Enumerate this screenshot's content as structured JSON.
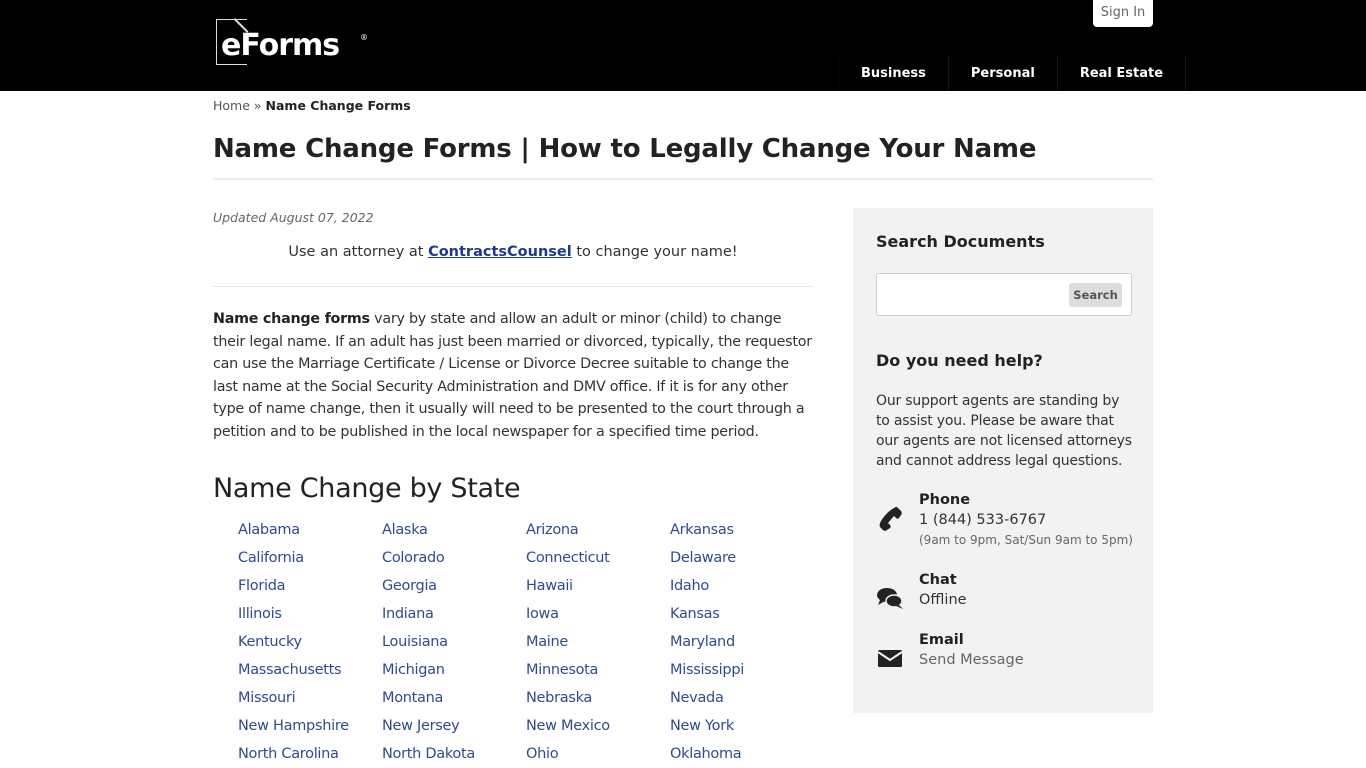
{
  "header": {
    "logo_text": "eForms",
    "logo_reg": "®",
    "signin_label": "Sign In",
    "nav": [
      {
        "label": "Business"
      },
      {
        "label": "Personal"
      },
      {
        "label": "Real Estate"
      }
    ]
  },
  "breadcrumb": {
    "home": "Home",
    "separator": "»",
    "current": "Name Change Forms"
  },
  "page": {
    "title": "Name Change Forms | How to Legally Change Your Name",
    "updated": "Updated August 07, 2022",
    "attorney": {
      "prefix": "Use an attorney at ",
      "link": "ContractsCounsel",
      "suffix": " to change your name!"
    },
    "intro": {
      "bold": "Name change forms",
      "text": " vary by state and allow an adult or minor (child) to change their legal name. If an adult has just been married or divorced, typically, the requestor can use the Marriage Certificate / License or Divorce Decree suitable to change the last name at the Social Security Administration and DMV office. If it is for any other type of name change, then it usually will need to be presented to the court through a petition and to be published in the local newspaper for a specified time period."
    },
    "state_heading": "Name Change by State",
    "states": [
      "Alabama",
      "Alaska",
      "Arizona",
      "Arkansas",
      "California",
      "Colorado",
      "Connecticut",
      "Delaware",
      "Florida",
      "Georgia",
      "Hawaii",
      "Idaho",
      "Illinois",
      "Indiana",
      "Iowa",
      "Kansas",
      "Kentucky",
      "Louisiana",
      "Maine",
      "Maryland",
      "Massachusetts",
      "Michigan",
      "Minnesota",
      "Mississippi",
      "Missouri",
      "Montana",
      "Nebraska",
      "Nevada",
      "New Hampshire",
      "New Jersey",
      "New Mexico",
      "New York",
      "North Carolina",
      "North Dakota",
      "Ohio",
      "Oklahoma"
    ]
  },
  "sidebar": {
    "search_heading": "Search Documents",
    "search_placeholder": "",
    "search_value": "",
    "search_button": "Search",
    "help_heading": "Do you need help?",
    "help_text": "Our support agents are standing by to assist you. Please be aware that our agents are not licensed attorneys and cannot address legal questions.",
    "contacts": {
      "phone": {
        "icon": "phone-icon",
        "label": "Phone",
        "value": "1 (844) 533-6767",
        "hours": "(9am to 9pm, Sat/Sun 9am to 5pm)"
      },
      "chat": {
        "icon": "chat-icon",
        "label": "Chat",
        "value": "Offline"
      },
      "email": {
        "icon": "envelope-icon",
        "label": "Email",
        "value": "Send Message"
      }
    }
  },
  "colors": {
    "header_bg": "#000000",
    "link": "#2f4b8f",
    "sidebar_bg": "#f2f2f2"
  }
}
